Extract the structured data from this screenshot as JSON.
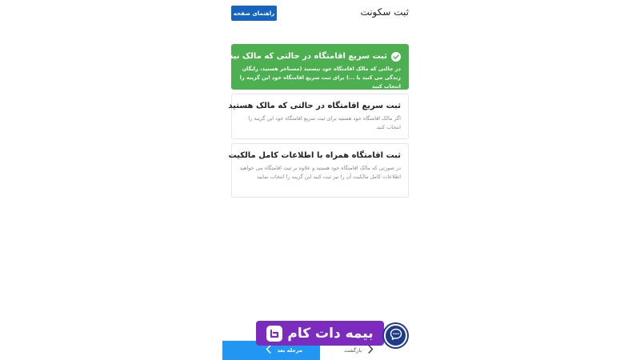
{
  "header": {
    "title": "ثبت سکونت",
    "help_button_label": "راهنمای صفحه"
  },
  "options": [
    {
      "title": "ثبت سریع اقامتگاه در حالتی که مالک نیستید",
      "description": "در حالتی که مالک اقامتگاه خود نیستید (مستاجر هستید، رایگان زندگی می کنید یا ...) برای ثبت سریع اقامتگاه خود این گزینه را انتخاب کنید",
      "selected": true
    },
    {
      "title": "ثبت سریع اقامتگاه در حالتی که مالک هستید",
      "description": "اگر مالک اقامتگاه خود هستید برای ثبت سریع اقامتگاه خود این گزینه را انتخاب کنید",
      "selected": false
    },
    {
      "title": "ثبت اقامتگاه همراه با اطلاعات کامل مالکیت",
      "description": "در صورتی که مالک اقامتگاه خود هستید و علاوه بر ثبت اقامتگاه می خواهید اطلاعات کامل مالکیت آن را نیز ثبت کنید این گزینه را انتخاب نمایید",
      "selected": false
    }
  ],
  "footer": {
    "next_label": "مرحله بعد",
    "back_label": "بازگشت"
  },
  "watermark": {
    "brand_text": "بیمه دات کام"
  },
  "colors": {
    "primary": "#1565c0",
    "selected_card": "#4caf50",
    "next_button": "#2196f3",
    "brand": "#7b2cbf",
    "chat_fab": "#1e3a8a"
  }
}
